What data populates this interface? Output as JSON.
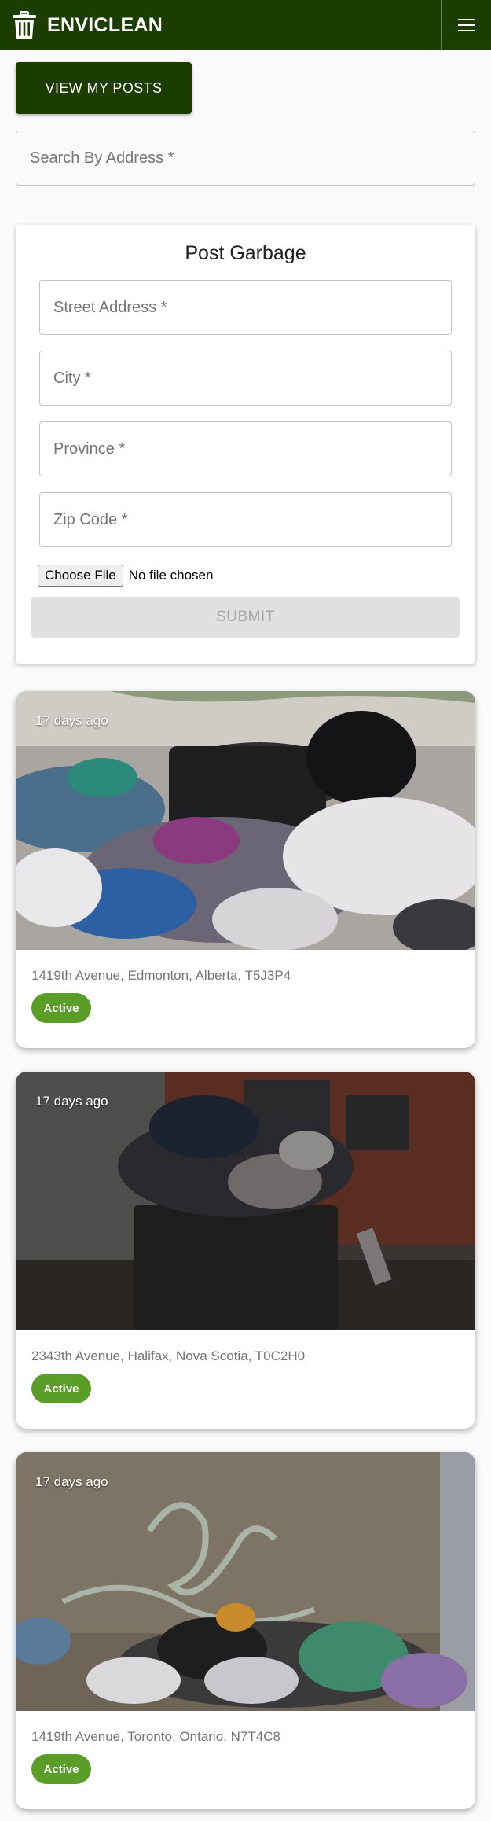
{
  "header": {
    "brand": "ENVICLEAN",
    "brand_icon": "trash-can-icon",
    "menu_icon": "hamburger-menu-icon",
    "colors": {
      "primary": "#1b3d00",
      "active_badge": "#5a9e28"
    }
  },
  "actions": {
    "view_posts_label": "VIEW MY POSTS"
  },
  "search": {
    "placeholder": "Search By Address *"
  },
  "post_form": {
    "title": "Post Garbage",
    "street_placeholder": "Street Address *",
    "city_placeholder": "City *",
    "province_placeholder": "Province *",
    "zip_placeholder": "Zip Code *",
    "file_button": "Choose File",
    "file_status": "No file chosen",
    "submit_label": "SUBMIT"
  },
  "posts": [
    {
      "time": "17 days ago",
      "address": "1419th Avenue, Edmonton, Alberta, T5J3P4",
      "status": "Active"
    },
    {
      "time": "17 days ago",
      "address": "2343th Avenue, Halifax, Nova Scotia, T0C2H0",
      "status": "Active"
    },
    {
      "time": "17 days ago",
      "address": "1419th Avenue, Toronto, Ontario, N7T4C8",
      "status": "Active"
    }
  ]
}
